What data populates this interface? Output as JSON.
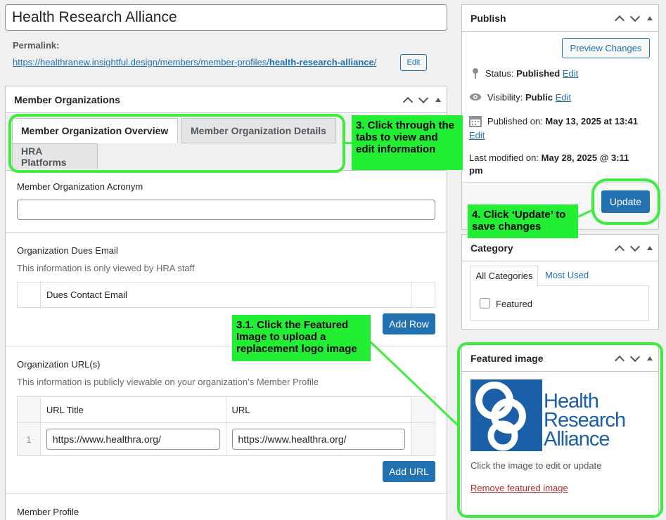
{
  "post": {
    "title": "Health Research Alliance",
    "permalink_label": "Permalink:",
    "permalink_base": "https://healthranew.insightful.design/members/member-profiles/",
    "permalink_slug": "health-research-alliance",
    "permalink_trailing": "/",
    "permalink_edit": "Edit"
  },
  "member_box": {
    "title": "Member Organizations",
    "tabs": [
      "Member Organization Overview",
      "Member Organization Details",
      "HRA Platforms"
    ],
    "acronym_label": "Member Organization Acronym",
    "acronym_value": "",
    "dues_label": "Organization Dues Email",
    "dues_desc": "This information is only viewed by HRA staff",
    "dues_column": "Dues Contact Email",
    "add_row": "Add Row",
    "url_label": "Organization URL(s)",
    "url_desc": "This information is publicly viewable on your organization’s Member Profile",
    "url_columns": [
      "URL Title",
      "URL"
    ],
    "url_row_number": "1",
    "url_title_value": "https://www.healthra.org/",
    "url_value": "https://www.healthra.org/",
    "add_url": "Add URL",
    "member_profile_label": "Member Profile"
  },
  "publish": {
    "title": "Publish",
    "preview": "Preview Changes",
    "status_label": "Status:",
    "status_value": "Published",
    "visibility_label": "Visibility:",
    "visibility_value": "Public",
    "edit": "Edit",
    "published_label": "Published on:",
    "published_value": "May 13, 2025 at 13:41",
    "modified_label": "Last modified on:",
    "modified_value_1": "May 28, 2025 @ 3:11",
    "modified_value_2": "pm",
    "update": "Update"
  },
  "category": {
    "title": "Category",
    "tabs": [
      "All Categories",
      "Most Used"
    ],
    "items": [
      "Featured"
    ]
  },
  "featured": {
    "title": "Featured image",
    "logo_lines": [
      "Health",
      "Research",
      "Alliance"
    ],
    "hint": "Click the image to edit or update",
    "remove": "Remove featured image"
  },
  "annotations": {
    "tabs_note": "3. Click through the tabs to view and edit information",
    "update_note": "4. Click ‘Update’ to save changes",
    "image_note": "3.1. Click the Featured Image to upload a replacement logo image"
  },
  "colors": {
    "accent": "#2271b1",
    "highlight": "#3ded3d",
    "logo_blue": "#1a5fa8",
    "remove_link": "#b32d2e"
  }
}
